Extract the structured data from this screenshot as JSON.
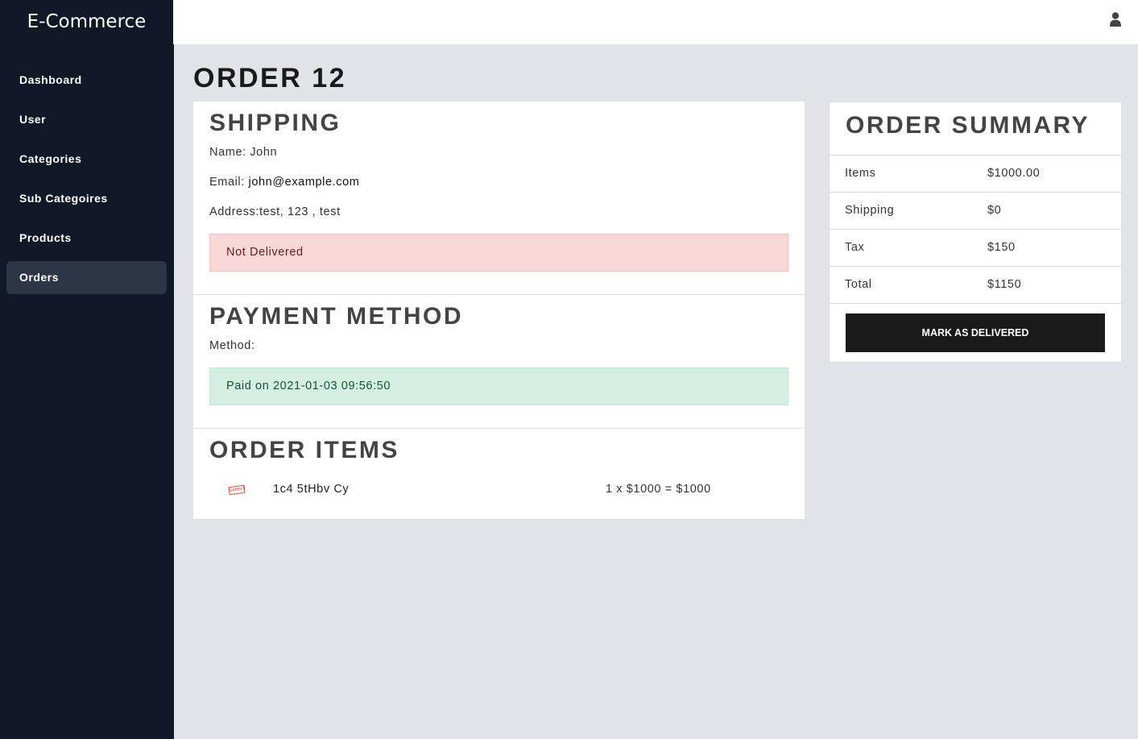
{
  "app": {
    "brand": "E-Commerce"
  },
  "sidebar": {
    "items": [
      {
        "label": "Dashboard"
      },
      {
        "label": "User"
      },
      {
        "label": "Categories"
      },
      {
        "label": "Sub Categoires"
      },
      {
        "label": "Products"
      },
      {
        "label": "Orders",
        "active": true
      }
    ]
  },
  "header": {
    "user_icon": "user-icon"
  },
  "page": {
    "title": "ORDER 12"
  },
  "shipping": {
    "title": "SHIPPING",
    "name_label": "Name: John",
    "email_label": "Email: ",
    "email": "john@example.com",
    "address_label": "Address:test, 123 , test",
    "status": "Not Delivered"
  },
  "payment": {
    "title": "PAYMENT METHOD",
    "method_label": "Method:",
    "status": "Paid on 2021-01-03 09:56:50"
  },
  "order_items": {
    "title": "ORDER ITEMS",
    "items": [
      {
        "image_text": "SAMPLE",
        "name": "1c4 5tHbv Cy",
        "calc": "1 x $1000 = $1000"
      }
    ]
  },
  "summary": {
    "title": "ORDER SUMMARY",
    "rows": [
      {
        "label": "Items",
        "value": "$1000.00"
      },
      {
        "label": "Shipping",
        "value": "$0"
      },
      {
        "label": "Tax",
        "value": "$150"
      },
      {
        "label": "Total",
        "value": "$1150"
      }
    ],
    "button_label": "MARK AS DELIVERED"
  },
  "colors": {
    "sidebar_bg": "#111827",
    "active_nav_bg": "#2d3646",
    "page_bg": "#e2e3e8",
    "danger_bg": "#f8d7d7",
    "success_bg": "#d4efe2",
    "button_bg": "#1a1a1a"
  }
}
